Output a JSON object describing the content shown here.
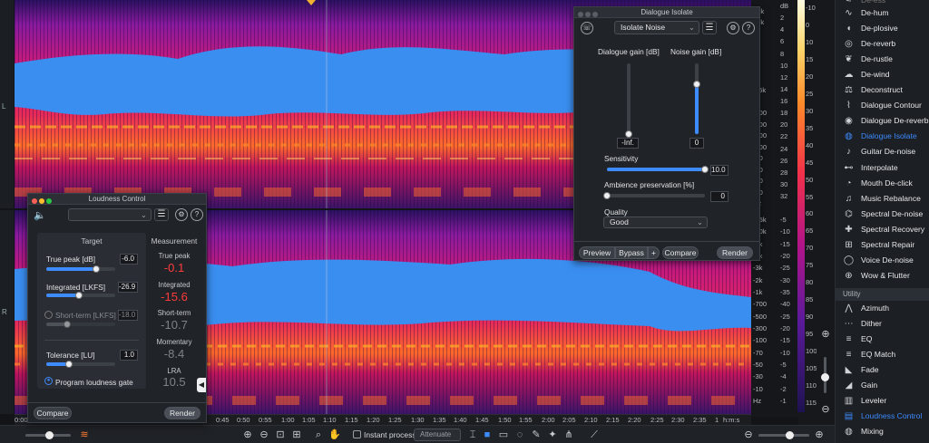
{
  "spectrogram": {
    "channel_top": "L",
    "channel_bottom": "R",
    "hz_ticks_top": [
      "15k",
      "10k",
      "6k",
      "5k",
      "4k",
      "3k",
      "2k",
      "1.5k",
      "1k",
      "-700",
      "-500",
      "-300",
      "-100",
      "-70",
      "-50",
      "-30",
      "-10",
      "Hz"
    ],
    "db_ticks_top": [
      "dB",
      "2",
      "4",
      "6",
      "8",
      "10",
      "12",
      "14",
      "16",
      "18",
      "20",
      "22",
      "24",
      "26",
      "28",
      "30",
      "32"
    ],
    "hz_ticks_bottom": [
      "-15k",
      "-10k",
      "-5k",
      "-4k",
      "-3k",
      "-2k",
      "-1k",
      "-700",
      "-500",
      "-300",
      "-100",
      "-70",
      "-50",
      "-30",
      "-10",
      "Hz"
    ],
    "db_ticks_bottom": [
      "-5",
      "-10",
      "-15",
      "-20",
      "-25",
      "-30",
      "-35",
      "-40",
      "-25",
      "-20",
      "-15",
      "-10",
      "-5",
      "-4",
      "-2",
      "-1"
    ],
    "colorbar_ticks": [
      "-10",
      "0",
      "10",
      "15",
      "20",
      "25",
      "30",
      "35",
      "40",
      "45",
      "50",
      "55",
      "60",
      "65",
      "70",
      "75",
      "80",
      "85",
      "90",
      "95",
      "100",
      "105",
      "110",
      "115"
    ],
    "timeline": [
      "0:00",
      "0:45",
      "0:50",
      "0:55",
      "1:00",
      "1:05",
      "1:10",
      "1:15",
      "1:20",
      "1:25",
      "1:30",
      "1:35",
      "1:40",
      "1:45",
      "1:50",
      "1:55",
      "2:00",
      "2:05",
      "2:10",
      "2:15",
      "2:20",
      "2:25",
      "2:30",
      "2:35",
      "1",
      "h:m:s"
    ]
  },
  "bottom_toolbar": {
    "instant_process": "Instant process",
    "attenuate": "Attenuate"
  },
  "dialogue_isolate": {
    "title": "Dialogue Isolate",
    "mode": "Isolate Noise",
    "dialogue_gain_label": "Dialogue gain [dB]",
    "noise_gain_label": "Noise gain [dB]",
    "dialogue_gain_value": "-Inf.",
    "noise_gain_value": "0",
    "dialogue_gain_level": 0.0,
    "noise_gain_level": 0.7,
    "sensitivity_label": "Sensitivity",
    "sensitivity_value": "10.0",
    "sensitivity_level": 1.0,
    "ambience_label": "Ambience preservation [%]",
    "ambience_value": "0",
    "ambience_level": 0.0,
    "quality_label": "Quality",
    "quality_value": "Good",
    "preview": "Preview",
    "bypass": "Bypass",
    "plus": "+",
    "compare": "Compare",
    "render": "Render"
  },
  "loudness_control": {
    "title": "Loudness Control",
    "target_header": "Target",
    "measurement_header": "Measurement",
    "true_peak_label": "True peak [dB]",
    "true_peak_value": "-6.0",
    "true_peak_level": 0.72,
    "integrated_label": "Integrated [LKFS]",
    "integrated_value": "-26.9",
    "integrated_level": 0.48,
    "short_term_label": "Short-term [LKFS]",
    "short_term_value": "-18.0",
    "short_term_level": 0.3,
    "tolerance_label": "Tolerance [LU]",
    "tolerance_value": "1.0",
    "tolerance_level": 0.33,
    "program_gate": "Program loudness gate",
    "m_true_peak_label": "True peak",
    "m_true_peak": "-0.1",
    "m_integrated_label": "Integrated",
    "m_integrated": "-15.6",
    "m_short_term_label": "Short-term",
    "m_short_term": "-10.7",
    "m_momentary_label": "Momentary",
    "m_momentary": "-8.4",
    "m_lra_label": "LRA",
    "m_lra": "10.5",
    "compare": "Compare",
    "render": "Render"
  },
  "modules": {
    "top_items": [
      "De-hum",
      "De-plosive",
      "De-reverb",
      "De-rustle",
      "De-wind",
      "Deconstruct",
      "Dialogue Contour",
      "Dialogue De-reverb",
      "Dialogue Isolate",
      "Guitar De-noise",
      "Interpolate",
      "Mouth De-click",
      "Music Rebalance",
      "Spectral De-noise",
      "Spectral Recovery",
      "Spectral Repair",
      "Voice De-noise",
      "Wow & Flutter"
    ],
    "section": "Utility",
    "utility_items": [
      "Azimuth",
      "Dither",
      "EQ",
      "EQ Match",
      "Fade",
      "Gain",
      "Leveler",
      "Loudness Control",
      "Mixing"
    ],
    "active_top": "Dialogue Isolate",
    "active_utility": "Loudness Control",
    "colors": {
      "accent": "#3d8bff",
      "warn": "#ff3b3b"
    }
  }
}
